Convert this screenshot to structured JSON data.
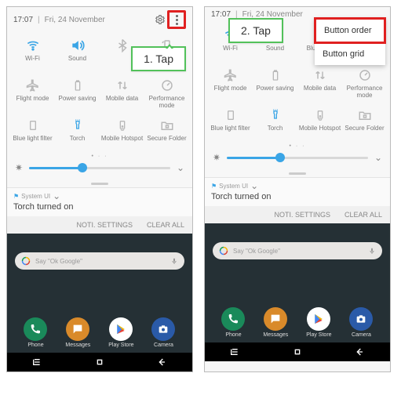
{
  "statusbar": {
    "time": "17:07",
    "date": "Fri, 24 November"
  },
  "callouts": {
    "tap1": "1. Tap",
    "tap2": "2. Tap"
  },
  "menu": {
    "order": "Button order",
    "grid": "Button grid"
  },
  "tiles": {
    "wifi": "Wi-Fi",
    "sound": "Sound",
    "bluetooth": "Bluetooth",
    "autorotate": "Auto rotate",
    "flight": "Flight mode",
    "power": "Power saving",
    "mdata": "Mobile data",
    "perf": "Performance mode",
    "bluelight": "Blue light filter",
    "torch": "Torch",
    "hotspot": "Mobile Hotspot",
    "secure": "Secure Folder"
  },
  "notif": {
    "app": "System UI",
    "body": "Torch turned on"
  },
  "actions": {
    "settings": "NOTI. SETTINGS",
    "clear": "CLEAR ALL"
  },
  "search": {
    "placeholder": "Say \"Ok Google\""
  },
  "apps": {
    "phone": "Phone",
    "messages": "Messages",
    "play": "Play Store",
    "camera": "Camera"
  }
}
